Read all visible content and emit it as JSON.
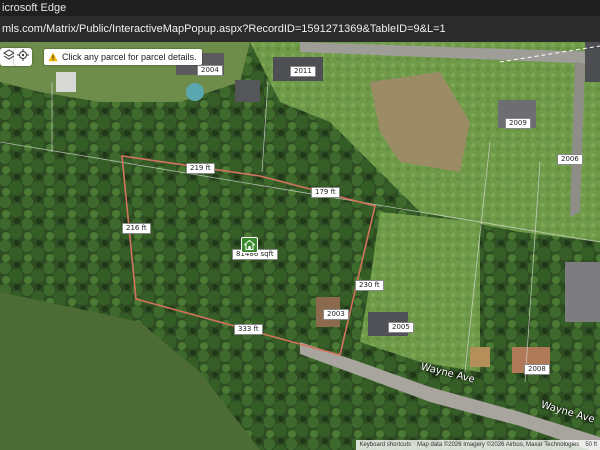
{
  "window": {
    "title": "icrosoft Edge",
    "url": "mls.com/Matrix/Public/InteractiveMapPopup.aspx?RecordID=1591271369&TableID=9&L=1"
  },
  "map": {
    "hint_text": "Click any parcel for parcel details.",
    "parcel_area": "81486 sqft",
    "dimensions": [
      "219 ft",
      "179 ft",
      "216 ft",
      "230 ft",
      "333 ft"
    ],
    "lot_numbers": [
      "2004",
      "2003",
      "2005",
      "2006",
      "2008",
      "2009",
      "2011"
    ],
    "streets": [
      "Wayne Ave",
      "Wayne Ave"
    ],
    "attribution": {
      "shortcuts": "Keyboard shortcuts",
      "copyright": "Map data ©2026 Imagery ©2026 Airbus, Maxar Technologies",
      "scale": "50 ft"
    }
  },
  "icons": [
    "layers-icon",
    "location-icon",
    "warning-icon",
    "home-icon"
  ],
  "colors": {
    "parcel_outline": "#d4735e",
    "titlebar": "#1f1f1f",
    "urlbar": "#2b2b2b",
    "warning": "#f2b705",
    "home_marker": "#3a8a2c"
  }
}
